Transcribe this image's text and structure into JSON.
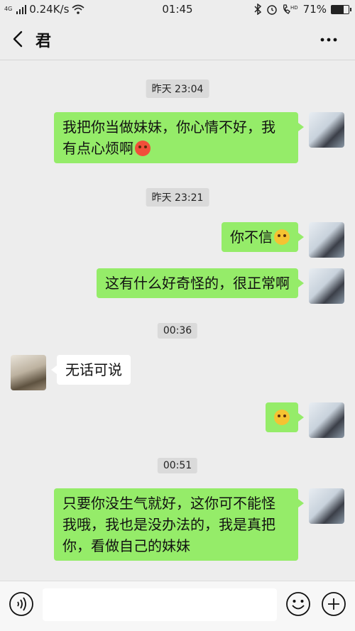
{
  "status_bar": {
    "signal_label": "4G",
    "net_speed": "0.24K/s",
    "time": "01:45",
    "hd_label": "HD",
    "battery": "71%",
    "battery_level": 0.71
  },
  "header": {
    "title": "君"
  },
  "messages": [
    {
      "kind": "time",
      "text": "昨天 23:04"
    },
    {
      "kind": "me",
      "lines": [
        "我把你当做妹妹，你心情不好，我",
        "有点心烦啊"
      ],
      "emoji": "angry-emoji"
    },
    {
      "kind": "time",
      "text": "昨天 23:21"
    },
    {
      "kind": "me",
      "text": "你不信",
      "emoji": "thinking-emoji"
    },
    {
      "kind": "me",
      "text": "这有什么好奇怪的，很正常啊"
    },
    {
      "kind": "time",
      "text": "00:36"
    },
    {
      "kind": "other",
      "text": "无话可说"
    },
    {
      "kind": "me",
      "text": "",
      "emoji": "wide-eyes-emoji"
    },
    {
      "kind": "time",
      "text": "00:51"
    },
    {
      "kind": "me",
      "lines": [
        "只要你没生气就好，这你可不能怪",
        "我哦，我也是没办法的，我是真把",
        "你，看做自己的妹妹"
      ]
    }
  ],
  "input": {
    "placeholder": ""
  },
  "colors": {
    "bubble_me": "#95ec69",
    "bubble_other": "#ffffff",
    "background": "#ededed"
  }
}
